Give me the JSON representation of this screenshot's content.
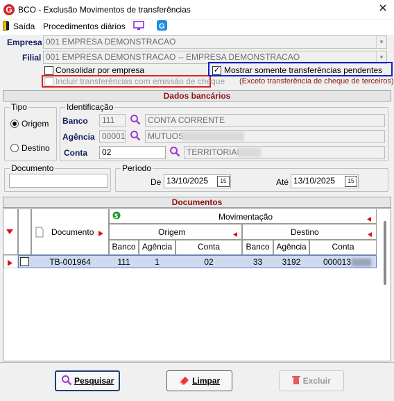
{
  "window": {
    "app_letter": "G",
    "title": "BCO - Exclusão Movimentos de transferências",
    "close_glyph": "✕"
  },
  "menu": {
    "saida": "Saída",
    "procedimentos": "Procedimentos diários"
  },
  "empresa": {
    "label": "Empresa",
    "value": "001 EMPRESA DEMONSTRACAO"
  },
  "filial": {
    "label": "Filial",
    "value": "001 EMPRESA DEMONSTRACAO -- EMPRESA DEMONSTRACAO"
  },
  "options": {
    "consolidar": "Consolidar por empresa",
    "incluir": "Incluir transferências com emissão de cheque",
    "mostrar": "Mostrar somente transferências pendentes",
    "exceto_note": "(Exceto transferência de cheque de terceiros)"
  },
  "dados_bancarios": {
    "header": "Dados bancários",
    "tipo": {
      "title": "Tipo",
      "origem": "Origem",
      "destino": "Destino",
      "selected": "Origem"
    },
    "identificacao": {
      "title": "Identificação",
      "banco_label": "Banco",
      "banco_code": "111",
      "banco_name": "CONTA CORRENTE",
      "agencia_label": "Agência",
      "agencia_code": "00001",
      "agencia_name": "MUTUOS",
      "conta_label": "Conta",
      "conta_code": "02",
      "conta_name": "TERRITORIAL"
    },
    "documento": {
      "title": "Documento",
      "value": ""
    },
    "periodo": {
      "title": "Período",
      "de_label": "De",
      "de_value": "13/10/2025",
      "ate_label": "Até",
      "ate_value": "13/10/2025",
      "calendar_icon_text": "15"
    }
  },
  "documentos": {
    "header": "Documentos",
    "col_documento": "Documento",
    "col_movimentacao": "Movimentação",
    "col_origem": "Origem",
    "col_destino": "Destino",
    "sub": {
      "banco": "Banco",
      "agencia": "Agência",
      "conta": "Conta"
    },
    "rows": [
      {
        "documento": "TB-001964",
        "orig_banco": "111",
        "orig_agencia": "1",
        "orig_conta": "02",
        "dest_banco": "33",
        "dest_agencia": "3192",
        "dest_conta": "000013"
      }
    ]
  },
  "buttons": {
    "pesquisar": "Pesquisar",
    "limpar": "Limpar",
    "excluir": "Excluir"
  },
  "colors": {
    "accent_red": "#8c1313",
    "row_selected": "#cfd9f0",
    "highlight_red": "#dd1f1f",
    "highlight_blue": "#1020c9"
  }
}
